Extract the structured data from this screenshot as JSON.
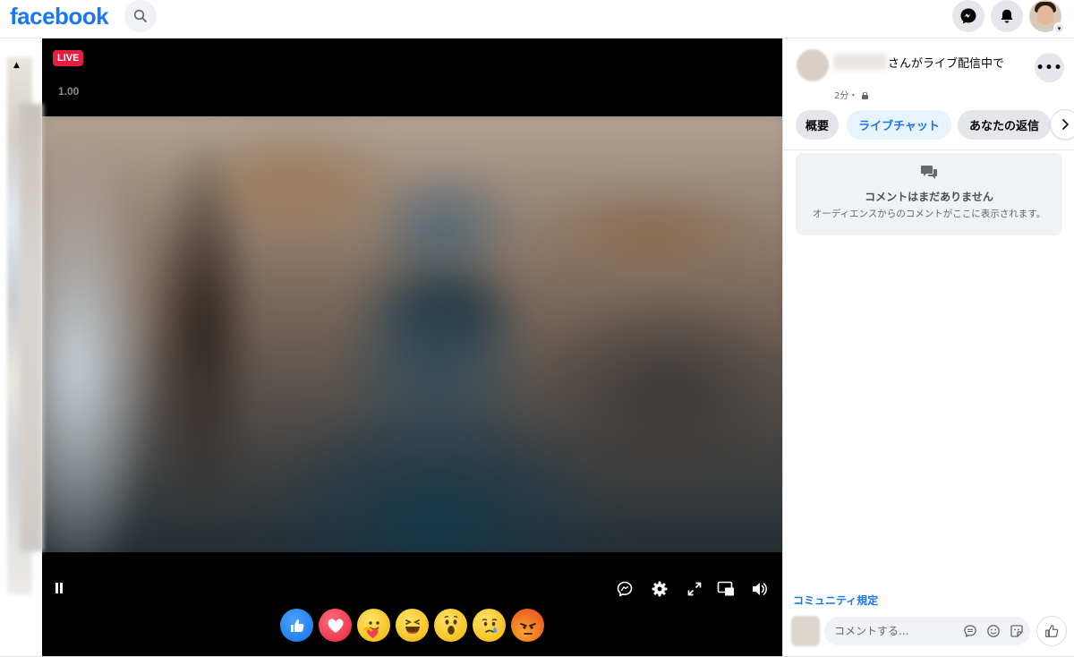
{
  "header": {
    "logo": "facebook",
    "icons": [
      "search-icon",
      "messenger-icon",
      "notifications-icon",
      "profile-avatar"
    ]
  },
  "video": {
    "live_label": "LIVE",
    "playback_speed": "1.00",
    "controls": [
      "pause-icon",
      "live-chat-icon",
      "settings-icon",
      "fullscreen-icon",
      "picture-in-picture-icon",
      "volume-icon"
    ],
    "reactions": [
      "like",
      "love",
      "care",
      "haha",
      "wow",
      "sad",
      "angry"
    ]
  },
  "sidebar": {
    "host_status": "さんがライブ配信中で",
    "time_ago": "2分・",
    "tabs": [
      "概要",
      "ライブチャット",
      "あなたの返信"
    ],
    "active_tab": "ライブチャット",
    "empty_title": "コメントはまだありません",
    "empty_subtitle": "オーディエンスからのコメントがここに表示されます。",
    "community_link": "コミュニティ規定",
    "comment_placeholder": "コメントする...",
    "colors": {
      "accent": "#1877f2",
      "live": "#e41e3f"
    }
  }
}
